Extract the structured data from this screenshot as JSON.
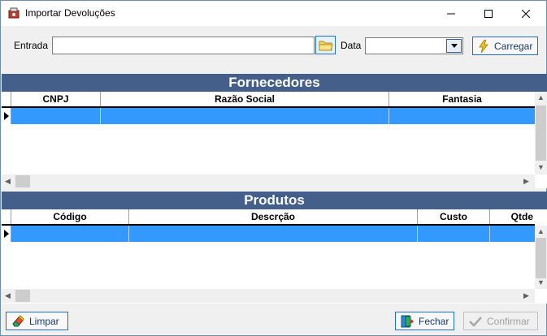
{
  "window": {
    "title": "Importar Devoluções"
  },
  "form": {
    "entrada_label": "Entrada",
    "entrada_value": "",
    "data_label": "Data",
    "data_value": "",
    "carregar_label": "Carregar"
  },
  "fornecedores": {
    "title": "Fornecedores",
    "columns": [
      "CNPJ",
      "Razão Social",
      "Fantasia"
    ]
  },
  "produtos": {
    "title": "Produtos",
    "columns": [
      "Código",
      "Descrção",
      "Custo",
      "Qtde"
    ]
  },
  "footer": {
    "limpar_label": "Limpar",
    "fechar_label": "Fechar",
    "confirmar_label": "Confirmar"
  },
  "colors": {
    "header_bg": "#435f8a",
    "selected_row": "#3399ff",
    "button_border": "#1e6fd0"
  }
}
